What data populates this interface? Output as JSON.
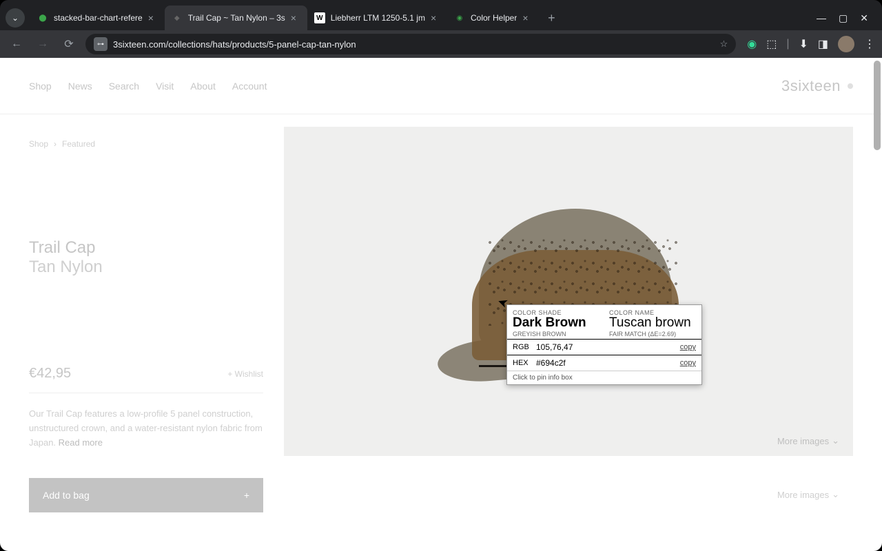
{
  "browser": {
    "tabs": [
      {
        "title": "stacked-bar-chart-refere",
        "favicon_color": "#3ba54a"
      },
      {
        "title": "Trail Cap ~ Tan Nylon – 3s",
        "favicon_color": "#444"
      },
      {
        "title": "Liebherr LTM 1250-5.1 jm",
        "favicon_color": "#fff"
      },
      {
        "title": "Color Helper",
        "favicon_color": "#3ba54a"
      }
    ],
    "active_tab": 1,
    "url": "3sixteen.com/collections/hats/products/5-panel-cap-tan-nylon"
  },
  "header": {
    "nav": [
      "Shop",
      "News",
      "Search",
      "Visit",
      "About",
      "Account"
    ],
    "brand": "3sixteen"
  },
  "breadcrumb": {
    "a": "Shop",
    "b": "Featured"
  },
  "product": {
    "title": "Trail Cap",
    "subtitle": "Tan Nylon",
    "price": "€42,95",
    "wishlist": "+ Wishlist",
    "desc": "Our Trail Cap features a low-profile 5 panel construction, unstructured crown, and a water-resistant nylon fabric from Japan. ",
    "readmore": "Read more",
    "addbag": "Add to bag",
    "moreimages": "More images"
  },
  "colorhelper": {
    "shade_label": "COLOR SHADE",
    "name_label": "COLOR NAME",
    "shade": "Dark Brown",
    "shade_sub": "GREYISH BROWN",
    "name": "Tuscan brown",
    "name_sub": "FAIR MATCH (ΔE=2.69)",
    "rgb_label": "RGB",
    "rgb": "105,76,47",
    "hex_label": "HEX",
    "hex": "#694c2f",
    "copy": "copy",
    "hint": "Click to pin info box"
  }
}
